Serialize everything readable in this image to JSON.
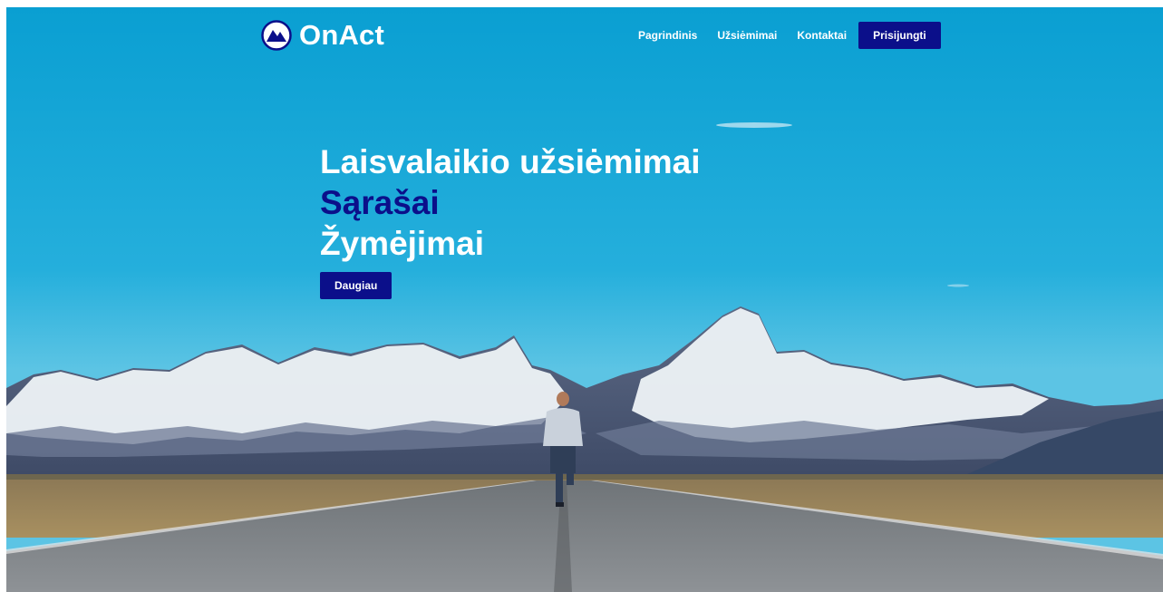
{
  "brand": {
    "name": "OnAct",
    "icon": "mountain-circle-icon"
  },
  "nav": {
    "links": [
      "Pagrindinis",
      "Užsiėmimai",
      "Kontaktai"
    ],
    "login_label": "Prisijungti"
  },
  "hero": {
    "lines": [
      "Laisvalaikio užsiėmimai",
      "Sąrašai",
      "Žymėjimai"
    ],
    "cta_label": "Daugiau",
    "background": "sky-mountains-road-runner-photo"
  },
  "colors": {
    "accent": "#0b0f8a",
    "sky": "#1aa3d4",
    "white": "#ffffff"
  }
}
